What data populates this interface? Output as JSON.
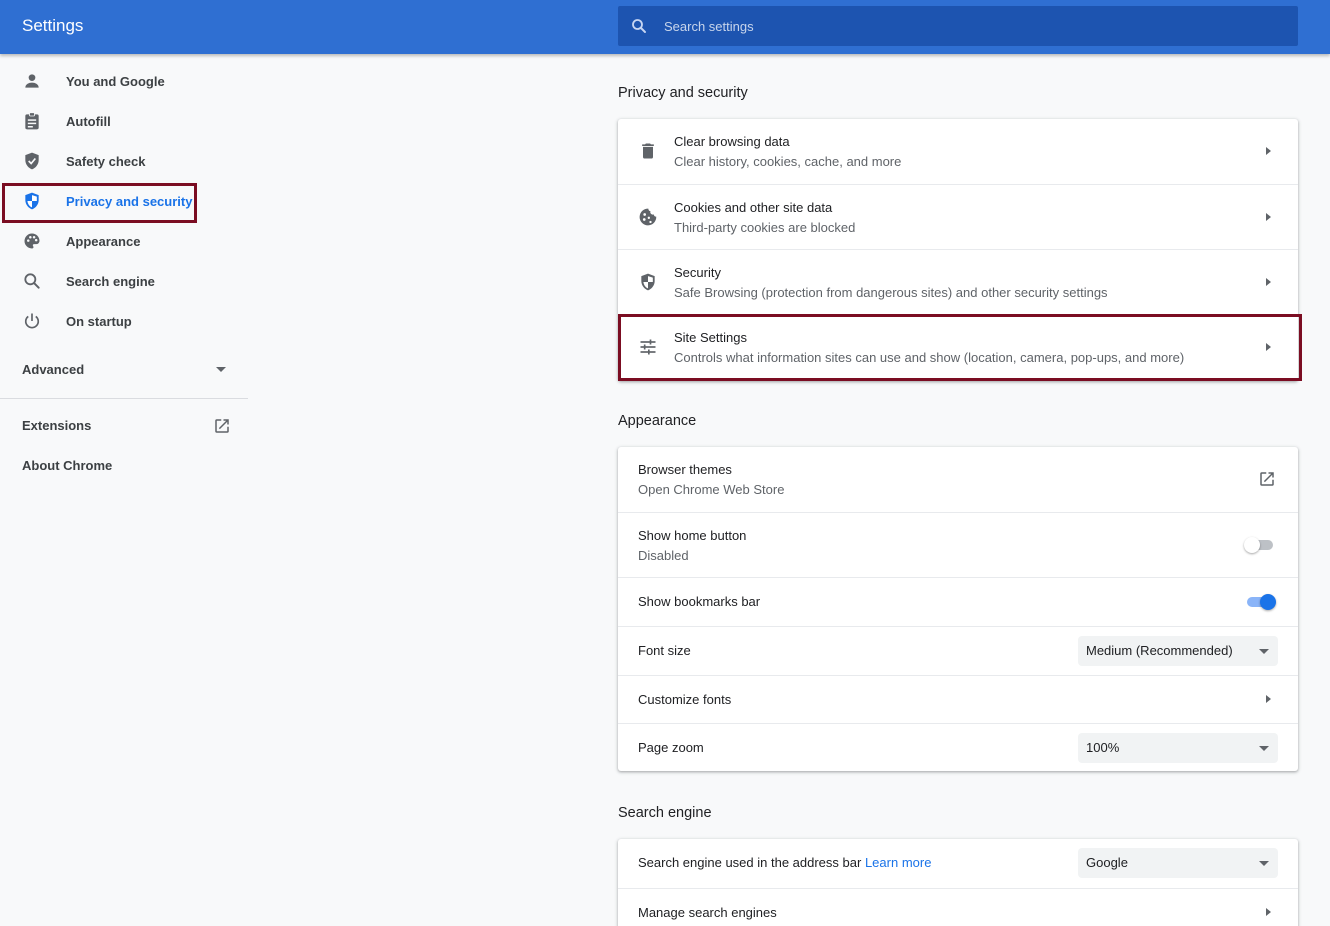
{
  "colors": {
    "header": "#2f6fd2",
    "search_bg": "#1d54b0",
    "accent": "#1a73e8",
    "highlight": "#7b0d22"
  },
  "header": {
    "title": "Settings"
  },
  "search": {
    "placeholder": "Search settings"
  },
  "sidebar": {
    "items": [
      {
        "label": "You and Google",
        "icon": "person-icon"
      },
      {
        "label": "Autofill",
        "icon": "clipboard-icon"
      },
      {
        "label": "Safety check",
        "icon": "shield-check-icon"
      },
      {
        "label": "Privacy and security",
        "icon": "shield-icon",
        "active": true
      },
      {
        "label": "Appearance",
        "icon": "palette-icon"
      },
      {
        "label": "Search engine",
        "icon": "search-icon"
      },
      {
        "label": "On startup",
        "icon": "power-icon"
      }
    ],
    "advanced": "Advanced",
    "extensions": "Extensions",
    "about": "About Chrome"
  },
  "privacy": {
    "title": "Privacy and security",
    "rows": [
      {
        "title": "Clear browsing data",
        "subtitle": "Clear history, cookies, cache, and more",
        "icon": "trash-icon"
      },
      {
        "title": "Cookies and other site data",
        "subtitle": "Third-party cookies are blocked",
        "icon": "cookie-icon"
      },
      {
        "title": "Security",
        "subtitle": "Safe Browsing (protection from dangerous sites) and other security settings",
        "icon": "shield-icon"
      },
      {
        "title": "Site Settings",
        "subtitle": "Controls what information sites can use and show (location, camera, pop-ups, and more)",
        "icon": "tune-icon"
      }
    ]
  },
  "appearance": {
    "title": "Appearance",
    "themes_title": "Browser themes",
    "themes_sub": "Open Chrome Web Store",
    "home_title": "Show home button",
    "home_sub": "Disabled",
    "home_on": false,
    "bookmarks_title": "Show bookmarks bar",
    "bookmarks_on": true,
    "font_size_title": "Font size",
    "font_size_value": "Medium (Recommended)",
    "custom_fonts_title": "Customize fonts",
    "zoom_title": "Page zoom",
    "zoom_value": "100%"
  },
  "search_engine": {
    "title": "Search engine",
    "used_label": "Search engine used in the address bar",
    "learn_more": "Learn more",
    "engine_value": "Google",
    "manage_title": "Manage search engines"
  }
}
